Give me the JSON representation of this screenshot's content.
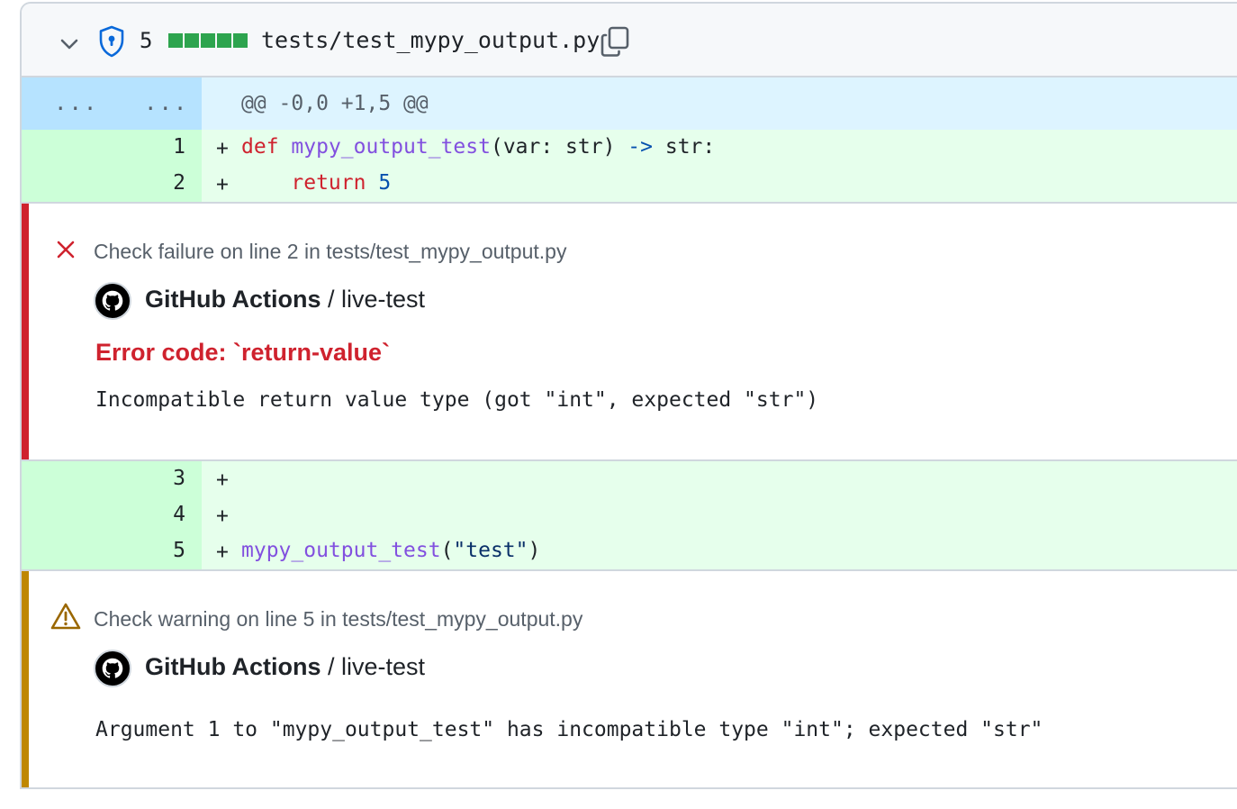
{
  "file": {
    "change_count": "5",
    "path": "tests/test_mypy_output.py",
    "diffstat_color": "#2da44e"
  },
  "hunk": {
    "left_dots": "...",
    "right_dots": "...",
    "header": "@@ -0,0 +1,5 @@"
  },
  "lines": [
    {
      "num": "1",
      "sign": "+",
      "tokens": [
        "def",
        " ",
        "mypy_output_test",
        "(var: str) ",
        "->",
        " str:"
      ]
    },
    {
      "num": "2",
      "sign": "+",
      "tokens": [
        "    ",
        "return",
        " ",
        "5"
      ]
    },
    {
      "num": "3",
      "sign": "+",
      "tokens": []
    },
    {
      "num": "4",
      "sign": "+",
      "tokens": []
    },
    {
      "num": "5",
      "sign": "+",
      "tokens": [
        "mypy_output_test",
        "(",
        "\"test\"",
        ")"
      ]
    }
  ],
  "annotations": [
    {
      "level": "failure",
      "bar_color": "#cf222e",
      "title": "Check failure on line 2 in tests/test_mypy_output.py",
      "app": "GitHub Actions",
      "job": " / live-test",
      "error_code": "Error code: `return-value`",
      "message": "Incompatible return value type (got \"int\", expected \"str\")"
    },
    {
      "level": "warning",
      "bar_color": "#bf8700",
      "title": "Check warning on line 5 in tests/test_mypy_output.py",
      "app": "GitHub Actions",
      "job": " / live-test",
      "message": "Argument 1 to \"mypy_output_test\" has incompatible type \"int\"; expected \"str\""
    }
  ]
}
